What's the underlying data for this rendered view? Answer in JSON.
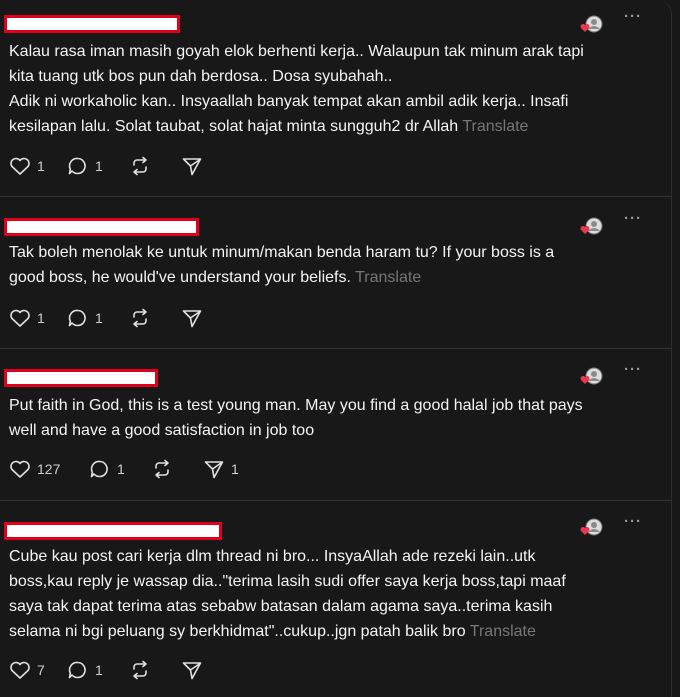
{
  "posts": [
    {
      "text": "Kalau rasa iman masih goyah elok berhenti kerja.. Walaupun tak minum arak tapi\nkita tuang utk bos pun dah berdosa.. Dosa syubahah..\nAdik ni workaholic kan.. Insyaallah banyak tempat akan ambil adik kerja.. Insafi\nkesilapan lalu. Solat taubat, solat hajat minta sungguh2 dr Allah",
      "translate": "Translate",
      "likes": "1",
      "replies": "1",
      "reposts": "",
      "shares": ""
    },
    {
      "text": "Tak boleh menolak ke untuk minum/makan benda haram tu? If your boss is a\ngood boss, he would've understand your beliefs.",
      "translate": "Translate",
      "likes": "1",
      "replies": "1",
      "reposts": "",
      "shares": ""
    },
    {
      "text": "Put faith in God, this is a test young man. May you find a good halal job that pays\nwell and have a good satisfaction in job too",
      "translate": "",
      "likes": "127",
      "replies": "1",
      "reposts": "",
      "shares": "1"
    },
    {
      "text": "Cube kau post cari kerja dlm thread ni bro... InsyaAllah ade rezeki lain..utk\nboss,kau reply je wassap dia..\"terima lasih sudi offer saya kerja boss,tapi maaf\nsaya tak dapat terima atas sebabw batasan dalam agama saya..terima kasih\nselama ni bgi peluang sy berkhidmat\"..cukup..jgn patah balik bro",
      "translate": "Translate",
      "likes": "7",
      "replies": "1",
      "reposts": "",
      "shares": ""
    }
  ],
  "more_glyph": "···",
  "colors": {
    "redaction_border": "#e0001b",
    "heart": "#e8384f"
  }
}
